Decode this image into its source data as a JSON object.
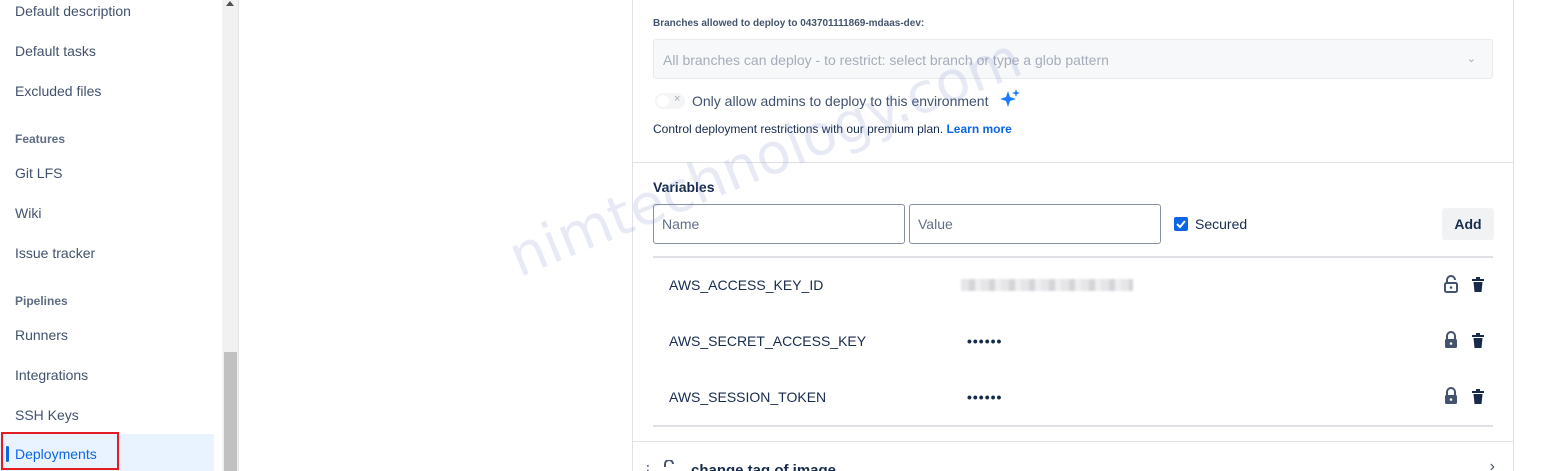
{
  "sidebar": {
    "items_top": [
      "Default description",
      "Default tasks",
      "Excluded files"
    ],
    "features_heading": "Features",
    "features": [
      "Git LFS",
      "Wiki",
      "Issue tracker"
    ],
    "pipelines_heading": "Pipelines",
    "pipelines": [
      "Runners",
      "Integrations",
      "SSH Keys",
      "Deployments"
    ]
  },
  "environment": {
    "branches_label": "Branches allowed to deploy to 043701111869-mdaas-dev:",
    "branches_placeholder": "All branches can deploy - to restrict: select branch or type a glob pattern",
    "admins_only_label": "Only allow admins to deploy to this environment",
    "admins_only_enabled": false,
    "premium_text": "Control deployment restrictions with our premium plan.",
    "learn_more": "Learn more"
  },
  "variables": {
    "title": "Variables",
    "name_placeholder": "Name",
    "value_placeholder": "Value",
    "secured_label": "Secured",
    "secured_checked": true,
    "add_label": "Add",
    "rows": [
      {
        "name": "AWS_ACCESS_KEY_ID",
        "value": "",
        "secured": false
      },
      {
        "name": "AWS_SECRET_ACCESS_KEY",
        "value": "••••••",
        "secured": true
      },
      {
        "name": "AWS_SESSION_TOKEN",
        "value": "••••••",
        "secured": true
      }
    ]
  },
  "next_block": {
    "title": "change tag of image"
  },
  "watermark": "nimtechnology.com",
  "colors": {
    "accent": "#0c66e4",
    "highlight": "#e31b23"
  }
}
